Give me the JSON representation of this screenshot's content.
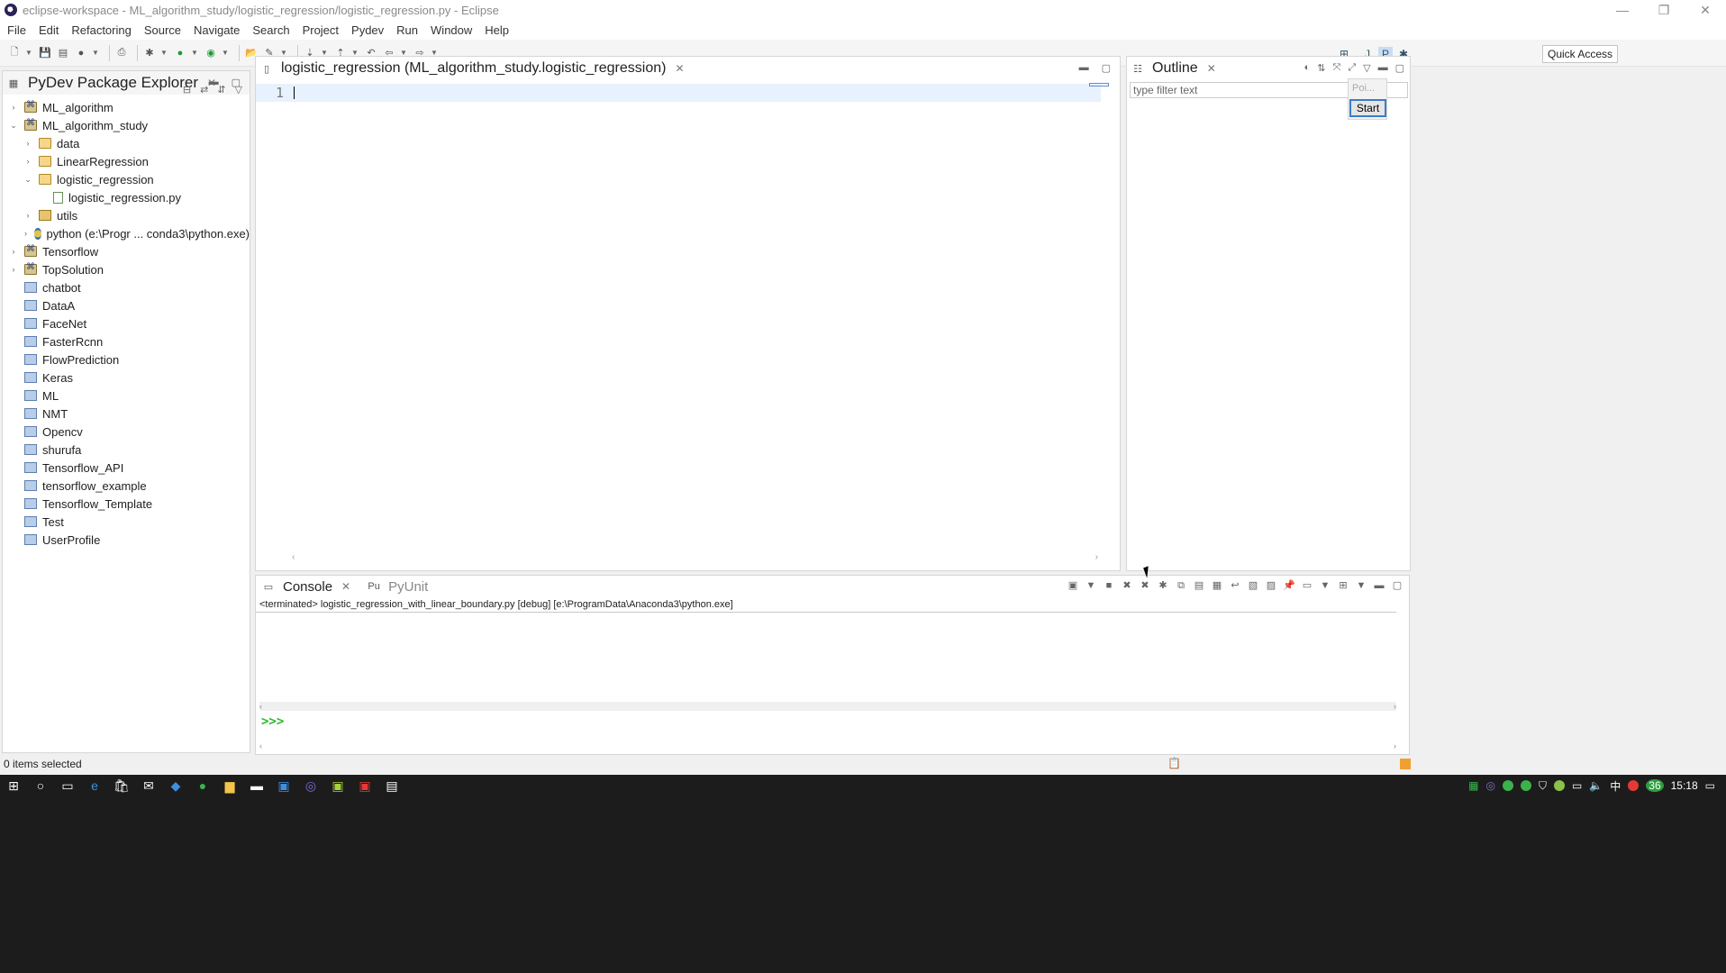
{
  "window": {
    "title": "eclipse-workspace - ML_algorithm_study/logistic_regression/logistic_regression.py - Eclipse",
    "minimize": "—",
    "maximize": "❐",
    "close": "✕"
  },
  "menu": [
    "File",
    "Edit",
    "Refactoring",
    "Source",
    "Navigate",
    "Search",
    "Project",
    "Pydev",
    "Run",
    "Window",
    "Help"
  ],
  "toolbar": {
    "quick_access": "Quick Access"
  },
  "explorer": {
    "title": "PyDev Package Explorer",
    "items": [
      {
        "label": "ML_algorithm",
        "depth": 0,
        "twisty": "›",
        "icon": "project-icon"
      },
      {
        "label": "ML_algorithm_study",
        "depth": 0,
        "twisty": "⌄",
        "icon": "project-icon"
      },
      {
        "label": "data",
        "depth": 1,
        "twisty": "›",
        "icon": "folder-icon"
      },
      {
        "label": "LinearRegression",
        "depth": 1,
        "twisty": "›",
        "icon": "folder-icon"
      },
      {
        "label": "logistic_regression",
        "depth": 1,
        "twisty": "⌄",
        "icon": "folder-icon"
      },
      {
        "label": "logistic_regression.py",
        "depth": 2,
        "twisty": "",
        "icon": "python-file-icon"
      },
      {
        "label": "utils",
        "depth": 1,
        "twisty": "›",
        "icon": "package-icon"
      },
      {
        "label": "python  (e:\\Progr ... conda3\\python.exe)",
        "depth": 1,
        "twisty": "›",
        "icon": "interpreter-icon"
      },
      {
        "label": "Tensorflow",
        "depth": 0,
        "twisty": "›",
        "icon": "project-icon"
      },
      {
        "label": "TopSolution",
        "depth": 0,
        "twisty": "›",
        "icon": "project-icon"
      },
      {
        "label": "chatbot",
        "depth": 0,
        "twisty": "",
        "icon": "closed-project-icon"
      },
      {
        "label": "DataA",
        "depth": 0,
        "twisty": "",
        "icon": "closed-project-icon"
      },
      {
        "label": "FaceNet",
        "depth": 0,
        "twisty": "",
        "icon": "closed-project-icon"
      },
      {
        "label": "FasterRcnn",
        "depth": 0,
        "twisty": "",
        "icon": "closed-project-icon"
      },
      {
        "label": "FlowPrediction",
        "depth": 0,
        "twisty": "",
        "icon": "closed-project-icon"
      },
      {
        "label": "Keras",
        "depth": 0,
        "twisty": "",
        "icon": "closed-project-icon"
      },
      {
        "label": "ML",
        "depth": 0,
        "twisty": "",
        "icon": "closed-project-icon"
      },
      {
        "label": "NMT",
        "depth": 0,
        "twisty": "",
        "icon": "closed-project-icon"
      },
      {
        "label": "Opencv",
        "depth": 0,
        "twisty": "",
        "icon": "closed-project-icon"
      },
      {
        "label": "shurufa",
        "depth": 0,
        "twisty": "",
        "icon": "closed-project-icon"
      },
      {
        "label": "Tensorflow_API",
        "depth": 0,
        "twisty": "",
        "icon": "closed-project-icon"
      },
      {
        "label": "tensorflow_example",
        "depth": 0,
        "twisty": "",
        "icon": "closed-project-icon"
      },
      {
        "label": "Tensorflow_Template",
        "depth": 0,
        "twisty": "",
        "icon": "closed-project-icon"
      },
      {
        "label": "Test",
        "depth": 0,
        "twisty": "",
        "icon": "closed-project-icon"
      },
      {
        "label": "UserProfile",
        "depth": 0,
        "twisty": "",
        "icon": "closed-project-icon"
      }
    ]
  },
  "editor": {
    "tab_title": "logistic_regression (ML_algorithm_study.logistic_regression)",
    "line_number": "1"
  },
  "outline": {
    "title": "Outline",
    "filter_placeholder": "type filter text",
    "popup_text": "Poi...",
    "start_button": "Start"
  },
  "console": {
    "tabs": [
      "Console",
      "PyUnit"
    ],
    "terminated_line": "<terminated> logistic_regression_with_linear_boundary.py [debug] [e:\\ProgramData\\Anaconda3\\python.exe]",
    "prompt": ">>>"
  },
  "status": {
    "selection": "0 items selected"
  },
  "taskbar": {
    "time": "15:18",
    "ime": "中",
    "badge": "36"
  },
  "colors": {
    "editor_current_line": "#e8f2fe",
    "prompt_green": "#28b828",
    "taskbar_bg": "#1c1c1c"
  }
}
